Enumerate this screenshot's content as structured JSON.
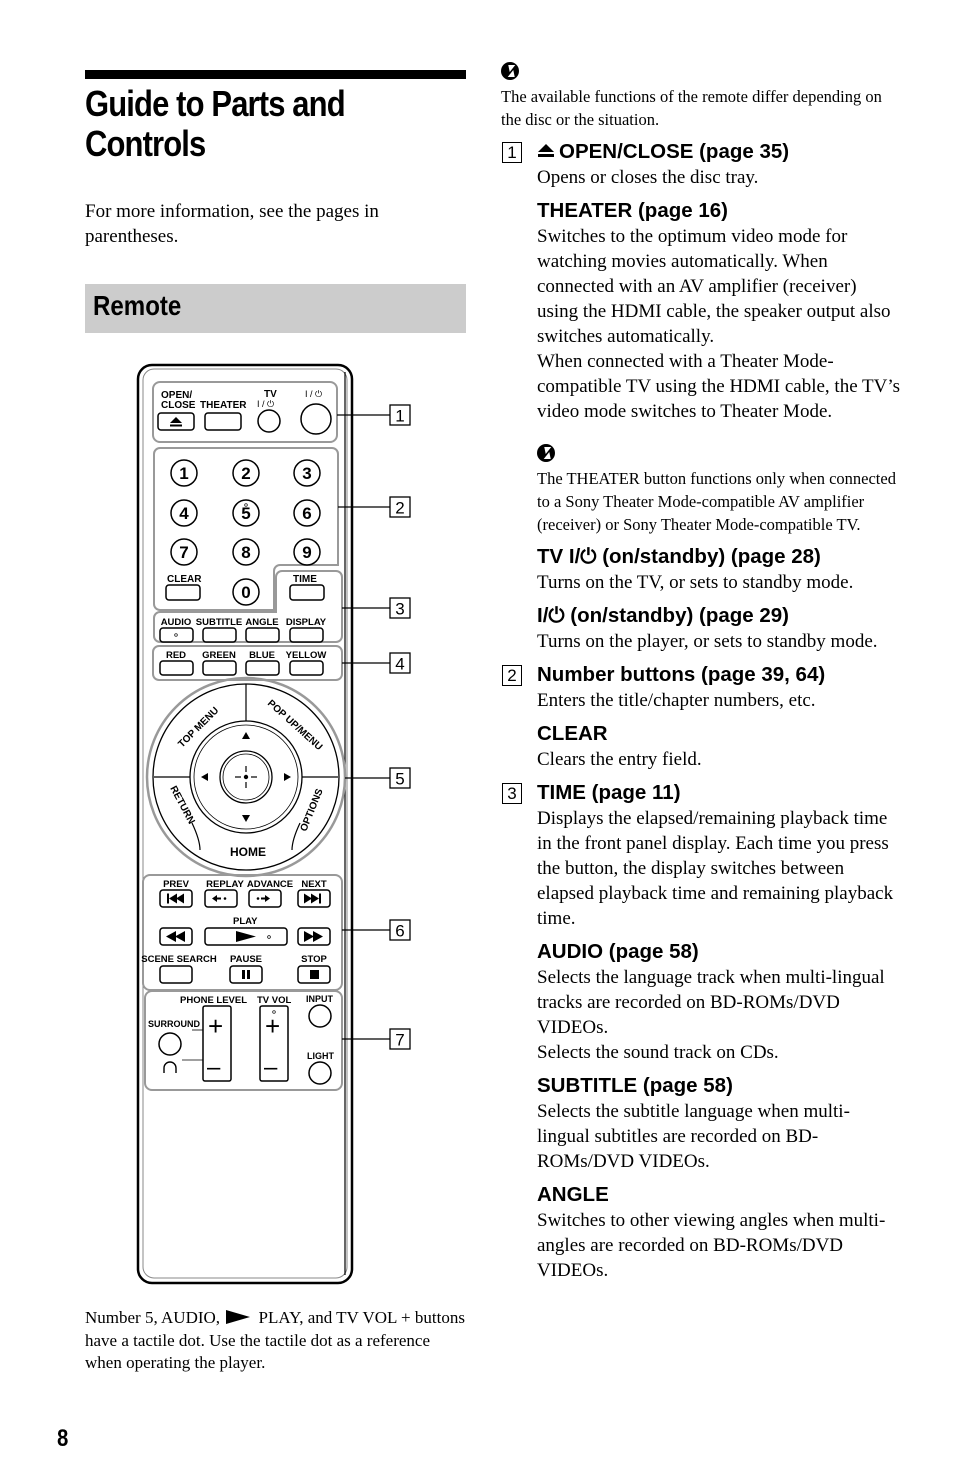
{
  "page": {
    "title": "Guide to Parts and Controls",
    "intro": "For more information, see the pages in parentheses.",
    "section": "Remote",
    "page_number": "8",
    "tactile_note": {
      "before": "Number 5, AUDIO, ",
      "after": " PLAY, and TV VOL + buttons have a tactile dot. Use the tactile dot as a reference when operating the player."
    }
  },
  "remote": {
    "callouts": [
      "1",
      "2",
      "3",
      "4",
      "5",
      "6",
      "7"
    ],
    "group1": {
      "open_close": "OPEN/",
      "open_close2": "CLOSE",
      "theater": "THEATER",
      "tv": "TV",
      "tv_power": "I / ⏻",
      "power": "I / ⏻"
    },
    "numbers": [
      "1",
      "2",
      "3",
      "4",
      "5",
      "6",
      "7",
      "8",
      "9",
      "0"
    ],
    "clear": "CLEAR",
    "time": "TIME",
    "row3": [
      "AUDIO",
      "SUBTITLE",
      "ANGLE",
      "DISPLAY"
    ],
    "colors": [
      "RED",
      "GREEN",
      "BLUE",
      "YELLOW"
    ],
    "nav": {
      "top_menu": "TOP MENU",
      "popup_menu": "POP UP/MENU",
      "return": "RETURN",
      "options": "OPTIONS",
      "home": "HOME"
    },
    "transport_top": [
      "PREV",
      "REPLAY",
      "ADVANCE",
      "NEXT"
    ],
    "play": "PLAY",
    "transport_bottom": [
      "SCENE SEARCH",
      "PAUSE",
      "STOP"
    ],
    "group7": {
      "phone_level": "PHONE LEVEL",
      "tv_vol": "TV VOL",
      "input": "INPUT",
      "surround": "SURROUND",
      "light": "LIGHT",
      "plus": "+",
      "minus": "–"
    }
  },
  "notes": {
    "top": "The available functions of the remote differ depending on the disc or the situation.",
    "theater": "The THEATER button functions only when connected to a Sony Theater Mode-compatible AV amplifier (receiver) or Sony Theater Mode-compatible TV."
  },
  "entries": [
    {
      "num": "1",
      "head": "OPEN/CLOSE (page 35)",
      "body": "Opens or closes the disc tray."
    },
    {
      "head": "THEATER (page 16)",
      "body": [
        "Switches to the optimum video mode for watching movies automatically. When connected with an AV amplifier (receiver) using the HDMI cable, the speaker output also switches automatically.",
        "When connected with a Theater Mode-compatible TV using the HDMI cable, the TV’s video mode switches to Theater Mode."
      ]
    },
    {
      "head": "TV I/⏻ (on/standby) (page 28)",
      "body": "Turns on the TV, or sets to standby mode."
    },
    {
      "head": "I/⏻ (on/standby) (page 29)",
      "body": "Turns on the player, or sets to standby mode."
    },
    {
      "num": "2",
      "head": "Number buttons (page 39, 64)",
      "body": "Enters the title/chapter numbers, etc."
    },
    {
      "head": "CLEAR",
      "body": "Clears the entry field."
    },
    {
      "num": "3",
      "head": "TIME (page 11)",
      "body": "Displays the elapsed/remaining playback time in the front panel display. Each time you press the button, the display switches between elapsed playback time and remaining playback time."
    },
    {
      "head": "AUDIO (page 58)",
      "body": [
        "Selects the language track when multi-lingual tracks are recorded on BD-ROMs/DVD VIDEOs.",
        "Selects the sound track on CDs."
      ]
    },
    {
      "head": "SUBTITLE (page 58)",
      "body": "Selects the subtitle language when multi-lingual subtitles are recorded on BD-ROMs/DVD VIDEOs."
    },
    {
      "head": "ANGLE",
      "body": "Switches to other viewing angles when multi-angles are recorded on BD-ROMs/DVD VIDEOs."
    }
  ]
}
